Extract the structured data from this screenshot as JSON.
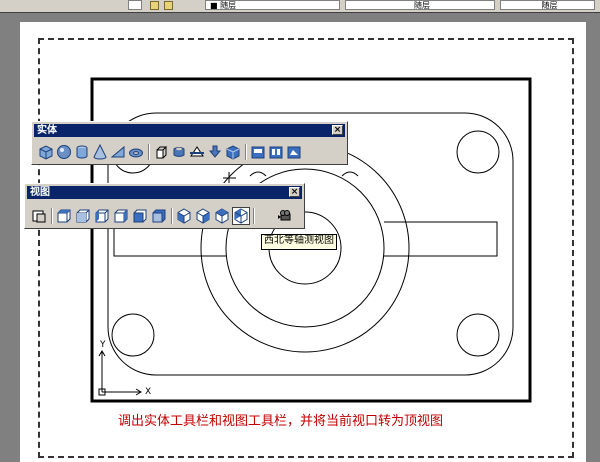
{
  "top_bar": {
    "layer_left": "■ 随层",
    "layer_mid": "随层",
    "layer_right": "随层"
  },
  "solids_toolbar": {
    "title": "实体",
    "close_label": "×",
    "buttons": [
      "box-icon",
      "sphere-icon",
      "cylinder-icon",
      "cone-icon",
      "wedge-icon",
      "torus-icon",
      "extrude-icon",
      "revolve-icon",
      "slice-icon",
      "section-icon",
      "interfere-icon",
      "setup-drawing-icon",
      "setup-view-icon",
      "setup-profile-icon"
    ]
  },
  "view_toolbar": {
    "title": "视图",
    "close_label": "×",
    "buttons": [
      "named-views-icon",
      "top-view-icon",
      "bottom-view-icon",
      "left-view-icon",
      "right-view-icon",
      "front-view-icon",
      "back-view-icon",
      "sw-isometric-icon",
      "se-isometric-icon",
      "ne-isometric-icon",
      "nw-isometric-icon",
      "camera-icon"
    ]
  },
  "tooltip": "西北等轴测视图",
  "caption": "调出实体工具栏和视图工具栏，并将当前视口转为顶视图",
  "ucs": {
    "x_label": "X",
    "y_label": "Y"
  }
}
